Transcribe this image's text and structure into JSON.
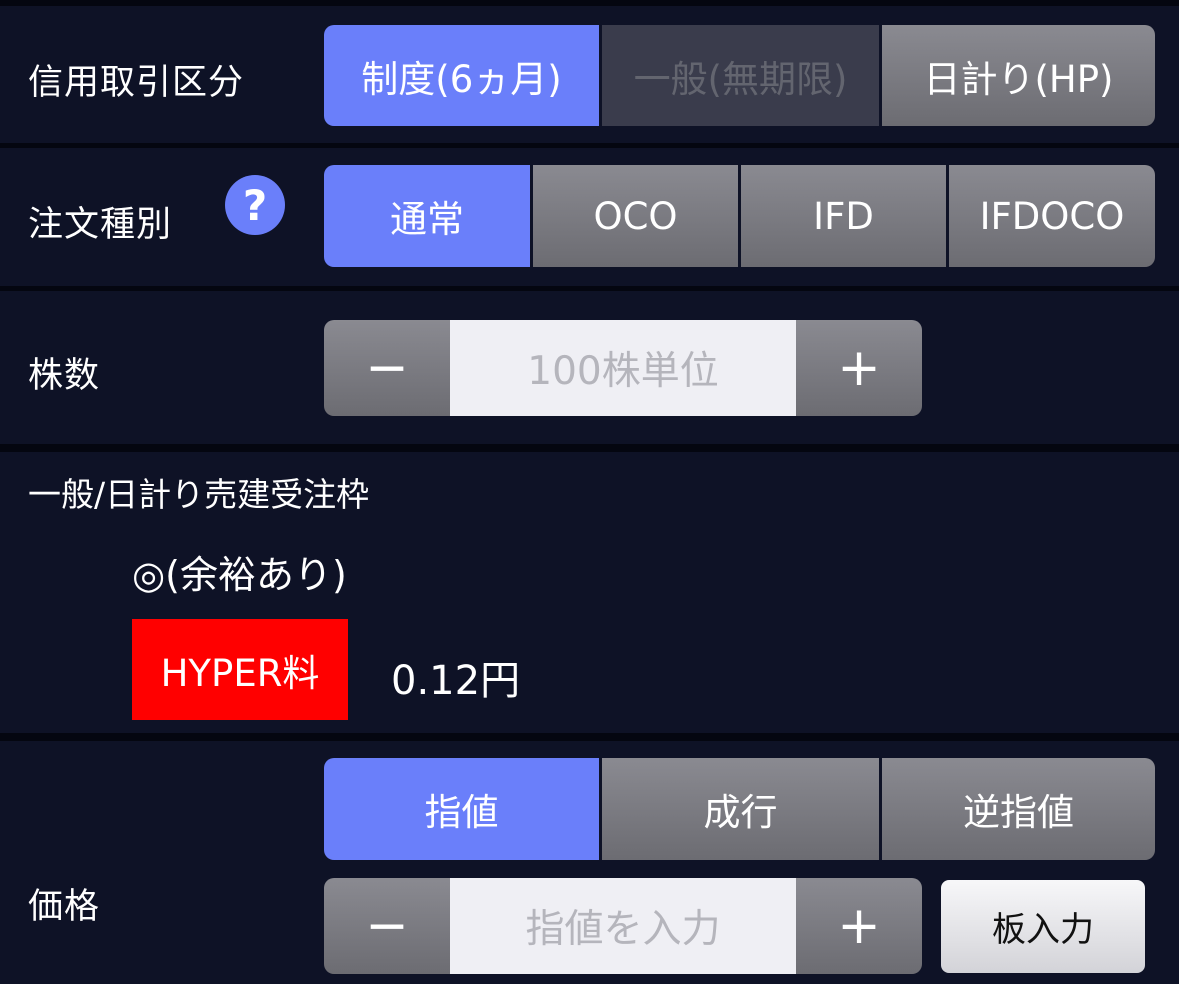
{
  "credit_type": {
    "label": "信用取引区分",
    "options": [
      "制度(6ヵ月)",
      "一般(無期限)",
      "日計り(HP)"
    ]
  },
  "order_type": {
    "label": "注文種別",
    "help_icon": "?",
    "options": [
      "通常",
      "OCO",
      "IFD",
      "IFDOCO"
    ]
  },
  "shares": {
    "label": "株数",
    "minus": "−",
    "placeholder": "100株単位",
    "plus": "+"
  },
  "quota": {
    "title": "一般/日計り売建受注枠",
    "status": "◎(余裕あり)",
    "hyper_badge": "HYPER料",
    "hyper_fee": "0.12円"
  },
  "price": {
    "label": "価格",
    "options": [
      "指値",
      "成行",
      "逆指値"
    ],
    "minus": "−",
    "placeholder": "指値を入力",
    "plus": "+",
    "board_input": "板入力"
  },
  "colors": {
    "active": "#6a7ffa",
    "inactive": "#7c7c82",
    "disabled": "#3a3c4c",
    "badge": "#ff0000",
    "background": "#0e1226"
  }
}
